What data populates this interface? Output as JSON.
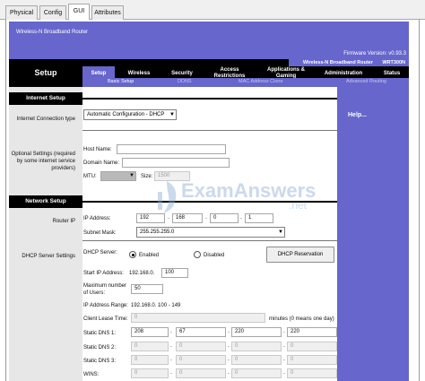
{
  "app_tabs": [
    "Physical",
    "Config",
    "GUI",
    "Attributes"
  ],
  "banner": {
    "product_name": "Wireless-N Broadband Router",
    "firmware": "Firmware Version: v0.93.3",
    "model_name": "Wireless-N Broadband Router",
    "model_number": "WRT300N"
  },
  "nav": {
    "section_title": "Setup",
    "tabs": [
      "Setup",
      "Wireless",
      "Security",
      "Access Restrictions",
      "Applications & Gaming",
      "Administration",
      "Status"
    ],
    "subtabs": [
      "Basic Setup",
      "DDNS",
      "MAC Address Clone",
      "Advanced Routing"
    ]
  },
  "help_label": "Help...",
  "internet_setup": {
    "heading": "Internet Setup",
    "conn_type_label": "Internet Connection type",
    "conn_type_value": "Automatic Configuration - DHCP",
    "optional_label": "Optional Settings (required by some internet service providers)",
    "host_name_label": "Host Name:",
    "domain_name_label": "Domain Name:",
    "mtu_label": "MTU:",
    "size_label": "Size:",
    "size_value": "1500"
  },
  "network_setup": {
    "heading": "Network Setup",
    "router_ip_label": "Router IP",
    "ip_address_label": "IP Address:",
    "ip": [
      "192",
      "168",
      "0",
      "1"
    ],
    "subnet_label": "Subnet Mask:",
    "subnet_value": "255.255.255.0",
    "dhcp_settings_label": "DHCP Server Settings",
    "dhcp_server_label": "DHCP Server:",
    "enabled_label": "Enabled",
    "disabled_label": "Disabled",
    "reservation_button": "DHCP Reservation",
    "start_ip_label": "Start IP Address:",
    "start_ip_prefix": "192.168.0.",
    "start_ip_value": "100",
    "max_users_label": "Maximum number of Users:",
    "max_users_value": "50",
    "ip_range_label": "IP Address Range:",
    "ip_range_value": "192.168.0.  100  -  149",
    "lease_label": "Client Lease Time:",
    "lease_value": "0",
    "lease_suffix": "minutes (0 means one day)",
    "dns1_label": "Static DNS 1:",
    "dns1": [
      "208",
      "67",
      "220",
      "220"
    ],
    "dns2_label": "Static DNS 2:",
    "dns2": [
      "0",
      "0",
      "0",
      "0"
    ],
    "dns3_label": "Static DNS 3:",
    "dns3": [
      "0",
      "0",
      "0",
      "0"
    ],
    "wins_label": "WINS:",
    "wins": [
      "0",
      "0",
      "0",
      "0"
    ]
  },
  "watermark": {
    "brand": "ExamAnswers",
    "suffix": ".net"
  }
}
